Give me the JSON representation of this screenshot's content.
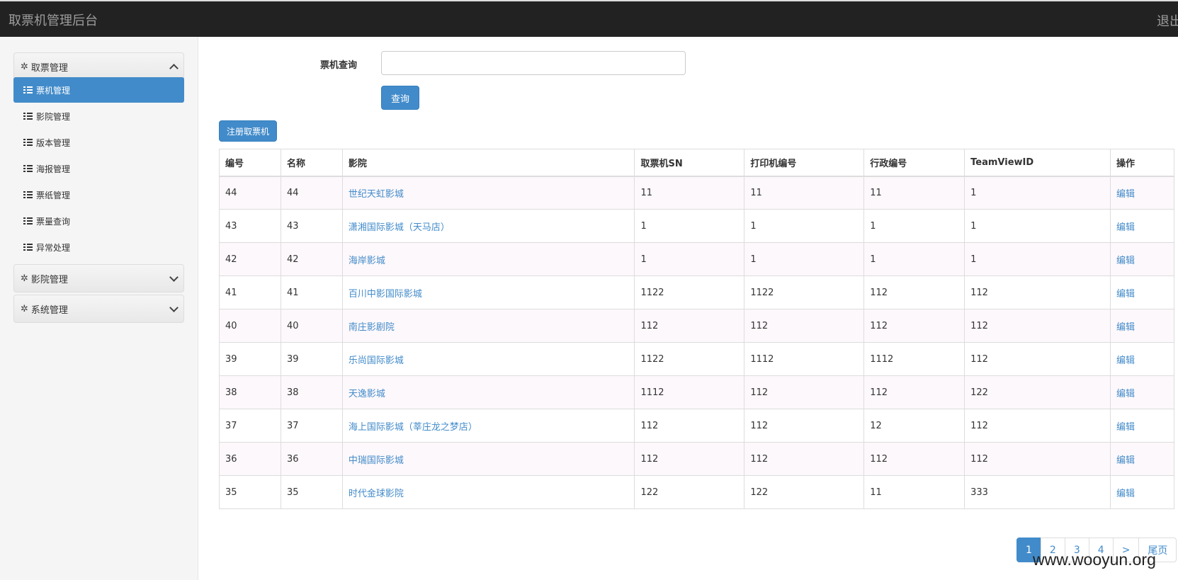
{
  "header": {
    "title": "取票机管理后台",
    "logout": "退出"
  },
  "sidebar": {
    "group1": {
      "label": "取票管理",
      "icon": "gear-icon"
    },
    "items": [
      {
        "label": "票机管理",
        "active": true
      },
      {
        "label": "影院管理"
      },
      {
        "label": "版本管理"
      },
      {
        "label": "海报管理"
      },
      {
        "label": "票纸管理"
      },
      {
        "label": "票量查询"
      },
      {
        "label": "异常处理"
      }
    ],
    "group2": {
      "label": "影院管理",
      "icon": "gear-icon"
    },
    "group3": {
      "label": "系统管理",
      "icon": "gear-icon"
    }
  },
  "search": {
    "label": "票机查询",
    "value": "",
    "button": "查询"
  },
  "register_button": "注册取票机",
  "table": {
    "headers": [
      "编号",
      "名称",
      "影院",
      "取票机SN",
      "打印机编号",
      "行政编号",
      "TeamViewID",
      "操作"
    ],
    "rows": [
      [
        "44",
        "44",
        "世纪天虹影城",
        "11",
        "11",
        "11",
        "1",
        "编辑"
      ],
      [
        "43",
        "43",
        "潇湘国际影城（天马店）",
        "1",
        "1",
        "1",
        "1",
        "编辑"
      ],
      [
        "42",
        "42",
        "海岸影城",
        "1",
        "1",
        "1",
        "1",
        "编辑"
      ],
      [
        "41",
        "41",
        "百川中影国际影城",
        "1122",
        "1122",
        "112",
        "112",
        "编辑"
      ],
      [
        "40",
        "40",
        "南庄影剧院",
        "112",
        "112",
        "112",
        "112",
        "编辑"
      ],
      [
        "39",
        "39",
        "乐尚国际影城",
        "1122",
        "1112",
        "1112",
        "112",
        "编辑"
      ],
      [
        "38",
        "38",
        "天逸影城",
        "1112",
        "112",
        "112",
        "122",
        "编辑"
      ],
      [
        "37",
        "37",
        "海上国际影城（莘庄龙之梦店）",
        "112",
        "112",
        "12",
        "112",
        "编辑"
      ],
      [
        "36",
        "36",
        "中瑞国际影城",
        "112",
        "112",
        "112",
        "112",
        "编辑"
      ],
      [
        "35",
        "35",
        "时代金球影院",
        "122",
        "122",
        "11",
        "333",
        "编辑"
      ]
    ]
  },
  "pagination": {
    "pages": [
      "1",
      "2",
      "3",
      "4",
      ">",
      "尾页"
    ],
    "current": "1"
  },
  "watermark": "www.wooyun.org",
  "colors": {
    "primary": "#428bca",
    "topbar": "#222222"
  }
}
